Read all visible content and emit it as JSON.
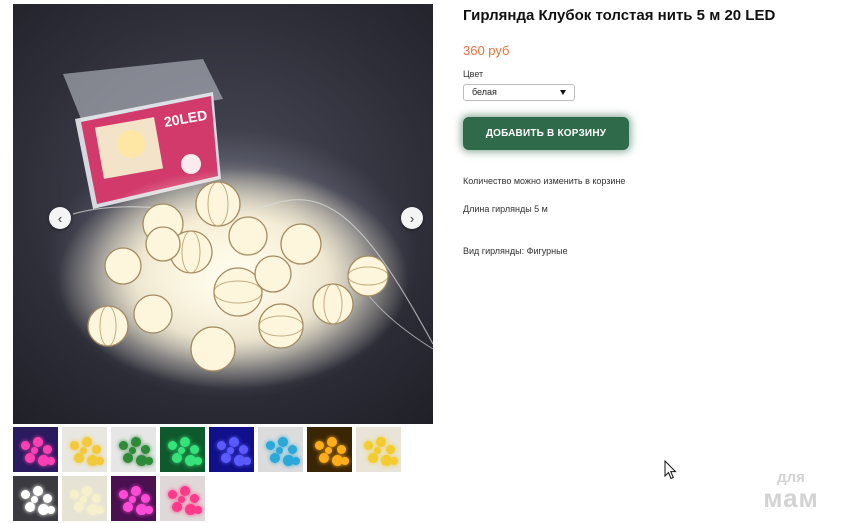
{
  "product": {
    "title": "Гирлянда Клубок толстая нить 5 м 20 LED",
    "price": "360 руб"
  },
  "options": {
    "color_label": "Цвет",
    "color_value": "белая"
  },
  "actions": {
    "add_to_cart": "ДОБАВИТЬ В КОРЗИНУ"
  },
  "info": {
    "quantity_note": "Количество можно изменить в корзине",
    "length": "Длина гирлянды 5 м",
    "type": "Вид гирлянды: Фигурные"
  },
  "box_label": "20LED",
  "gallery": {
    "thumbnails": [
      {
        "bg": "#2a1a5e",
        "dot": "#ff3fb4"
      },
      {
        "bg": "#e9e7e2",
        "dot": "#f2c93a"
      },
      {
        "bg": "#e6e6e6",
        "dot": "#2f8a3a"
      },
      {
        "bg": "#0f5a2c",
        "dot": "#36e27a"
      },
      {
        "bg": "#10108a",
        "dot": "#5a5aff"
      },
      {
        "bg": "#dcdcdc",
        "dot": "#2aa9d9"
      },
      {
        "bg": "#3a2505",
        "dot": "#ffae1a"
      },
      {
        "bg": "#e8e4d8",
        "dot": "#f2cc30"
      },
      {
        "bg": "#3a3a40",
        "dot": "#ffffff"
      },
      {
        "bg": "#e6e2d4",
        "dot": "#f6f0cc"
      },
      {
        "bg": "#4a1050",
        "dot": "#ff4bd8"
      },
      {
        "bg": "#e0d8d8",
        "dot": "#ff3a8a"
      }
    ]
  },
  "watermark": {
    "line1": "для",
    "line2": "мам"
  }
}
